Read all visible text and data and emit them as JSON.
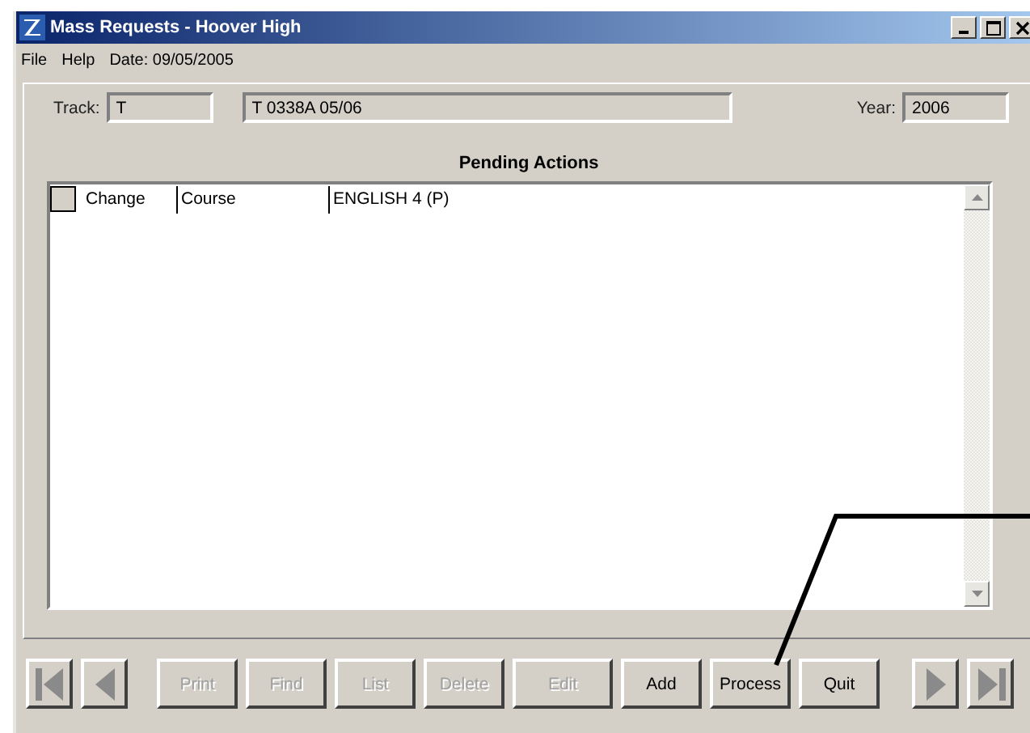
{
  "window": {
    "title": "Mass Requests - Hoover High"
  },
  "menu": [
    "File",
    "Help"
  ],
  "date": "Date: 09/05/2005",
  "fields": [
    {
      "label": "Track:",
      "value": "T",
      "kind": "short"
    },
    {
      "value": "T 0338A 05/06",
      "kind": "wide"
    },
    {
      "label": "Year:",
      "value": "2006",
      "kind": "short"
    }
  ],
  "section_title": "Pending Actions",
  "rows": [
    {
      "checked": false,
      "action": "Change",
      "type": "Course",
      "value": "ENGLISH 4 (P)"
    }
  ],
  "buttons": [
    {
      "label": "Print",
      "disabled": true
    },
    {
      "label": "Find",
      "disabled": true
    },
    {
      "label": "List",
      "disabled": true
    },
    {
      "label": "Delete",
      "disabled": true
    },
    {
      "label": "Edit",
      "disabled": true
    },
    {
      "label": "Add",
      "disabled": false
    },
    {
      "label": "Process",
      "disabled": false
    },
    {
      "label": "Quit",
      "disabled": false
    }
  ]
}
